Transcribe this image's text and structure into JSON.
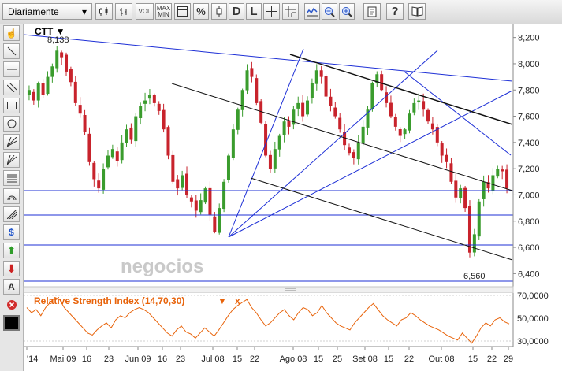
{
  "toolbar": {
    "period_selected": "Diariamente",
    "vol_label": "VOL",
    "maxmin_label_top": "MAX",
    "maxmin_label_bottom": "MIN",
    "percent_label": "%",
    "daily_label": "D",
    "line_label": "L",
    "help_label": "?"
  },
  "sidebar": {
    "text_tool_label": "A"
  },
  "chart": {
    "ticker": "CTT ▼",
    "watermark": "negocios",
    "high_label": "8,138",
    "low_label": "6,560",
    "price_axis": [
      "8,200",
      "8,000",
      "7,800",
      "7,600",
      "7,400",
      "7,200",
      "7,000",
      "6,800",
      "6,600",
      "6,400"
    ],
    "date_axis": [
      "'14",
      "Mai 09",
      "16",
      "23",
      "Jun 09",
      "16",
      "23",
      "Jul 08",
      "15",
      "22",
      "Ago 08",
      "15",
      "25",
      "Set 08",
      "15",
      "22",
      "Out 08",
      "15",
      "22",
      "29"
    ],
    "colors": {
      "up": "#3a9c2d",
      "down": "#c8232c",
      "trend_blue": "#1d2fd6",
      "trend_black": "#111111",
      "rsi_line": "#e8630a"
    }
  },
  "rsi": {
    "title": "Relative Strength Index (14,70,30)",
    "menu_glyph": "▼",
    "close_glyph": "x",
    "axis": [
      "70,0000",
      "50,0000",
      "30,0000"
    ]
  },
  "chart_data": {
    "type": "candlestick",
    "ylim": [
      6300,
      8300
    ],
    "high": 8138,
    "low": 6560,
    "closes": [
      7800,
      7720,
      7850,
      7760,
      7900,
      7980,
      8100,
      8050,
      7940,
      7860,
      7700,
      7620,
      7480,
      7250,
      7120,
      7050,
      7200,
      7300,
      7350,
      7260,
      7400,
      7500,
      7420,
      7600,
      7680,
      7720,
      7760,
      7700,
      7640,
      7500,
      7300,
      7100,
      7050,
      7150,
      7000,
      6950,
      6880,
      6960,
      7050,
      6850,
      6720,
      6900,
      7100,
      7300,
      7500,
      7650,
      7800,
      7950,
      7900,
      7700,
      7550,
      7300,
      7200,
      7350,
      7450,
      7560,
      7520,
      7650,
      7700,
      7600,
      7720,
      7850,
      7950,
      7900,
      7750,
      7680,
      7600,
      7500,
      7380,
      7320,
      7280,
      7400,
      7520,
      7650,
      7850,
      7920,
      7800,
      7700,
      7600,
      7520,
      7450,
      7500,
      7620,
      7700,
      7720,
      7650,
      7560,
      7500,
      7400,
      7300,
      7250,
      7100,
      6980,
      7050,
      6900,
      6560,
      6700,
      6950,
      7100,
      7050,
      7150,
      7200,
      7180,
      7050
    ],
    "trendlines_blue": [
      "fan from 6,620 (Jul 15) to Ago 08 high",
      "fan from 6,620 (Jul 15) to Set 15 high",
      "fan from 6,620 (Jul 15) to Out 29",
      "resistance from 8,250 ('14) to 7,880",
      "from Set 22 high to Out 29"
    ],
    "trendlines_black": [
      "upper channel from Jun 23 high",
      "lower channel from Jul 22",
      "resistance from Ago 08 high"
    ],
    "hlines": [
      6990,
      6800,
      6560
    ],
    "rsi_ylim": [
      24,
      72
    ],
    "rsi_values": [
      60,
      55,
      58,
      52,
      60,
      65,
      70,
      68,
      60,
      55,
      50,
      45,
      40,
      35,
      33,
      38,
      42,
      45,
      40,
      48,
      52,
      50,
      55,
      58,
      60,
      58,
      55,
      50,
      45,
      40,
      35,
      32,
      38,
      42,
      36,
      34,
      30,
      35,
      40,
      36,
      32,
      38,
      45,
      52,
      58,
      62,
      65,
      68,
      60,
      55,
      48,
      42,
      45,
      50,
      55,
      58,
      52,
      48,
      55,
      60,
      58,
      52,
      55,
      62,
      55,
      50,
      45,
      42,
      40,
      38,
      45,
      50,
      55,
      60,
      64,
      58,
      52,
      48,
      45,
      42,
      48,
      50,
      55,
      52,
      48,
      45,
      42,
      40,
      38,
      35,
      32,
      30,
      28,
      35,
      30,
      25,
      32,
      40,
      45,
      42,
      48,
      50,
      46,
      44
    ]
  }
}
